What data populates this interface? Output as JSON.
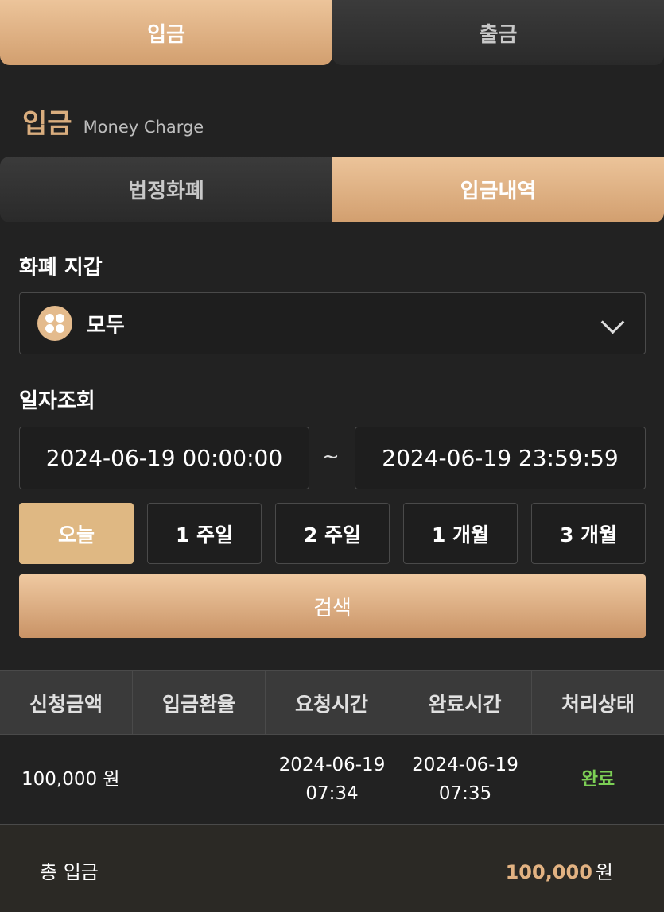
{
  "top_tabs": {
    "deposit": "입금",
    "withdraw": "출금"
  },
  "section": {
    "title": "입금",
    "subtitle": "Money Charge"
  },
  "sub_tabs": {
    "fiat": "법정화폐",
    "history": "입금내역"
  },
  "wallet": {
    "label": "화폐 지갑",
    "selected": "모두",
    "icon": "four-dots-coin-icon"
  },
  "date_query": {
    "label": "일자조회",
    "start": "2024-06-19 00:00:00",
    "separator": "~",
    "end": "2024-06-19 23:59:59"
  },
  "periods": [
    "오늘",
    "1 주일",
    "2 주일",
    "1 개월",
    "3 개월"
  ],
  "active_period": "오늘",
  "search_label": "검색",
  "table": {
    "headers": [
      "신청금액",
      "입금환율",
      "요청시간",
      "완료시간",
      "처리상태"
    ],
    "rows": [
      {
        "amount": "100,000 원",
        "rate": "",
        "request_date": "2024-06-19",
        "request_time": "07:34",
        "complete_date": "2024-06-19",
        "complete_time": "07:35",
        "status": "완료"
      }
    ]
  },
  "total": {
    "label": "총 입금",
    "value": "100,000",
    "unit": "원"
  },
  "colors": {
    "accent": "#dfb883",
    "status_done": "#7ccf55",
    "background": "#222222"
  }
}
